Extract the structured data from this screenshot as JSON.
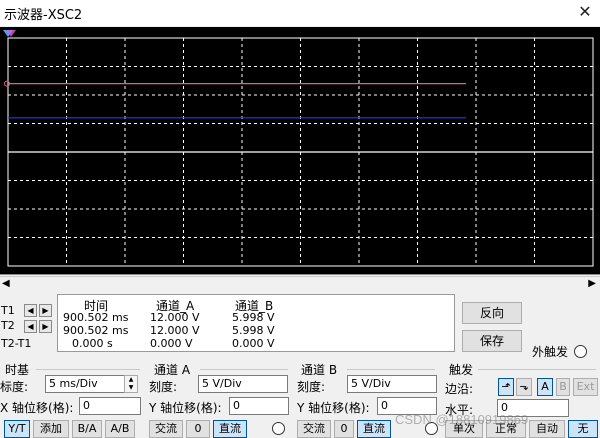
{
  "window": {
    "title": "示波器-XSC2",
    "close": "✕"
  },
  "cursors": {
    "t1_label": "T1",
    "t2_label": "T2",
    "diff_label": "T2-T1",
    "headers": {
      "time": "时间",
      "a": "通道_A",
      "b": "通道_B"
    },
    "rows": [
      {
        "time": "900.502 ms",
        "a": "12.000 V",
        "b": "5.998 V"
      },
      {
        "time": "900.502 ms",
        "a": "12.000 V",
        "b": "5.998 V"
      },
      {
        "time": "0.000 s",
        "a": "0.000 V",
        "b": "0.000 V"
      }
    ]
  },
  "buttons": {
    "reverse": "反向",
    "save": "保存",
    "ext_trigger": "外触发"
  },
  "timebase": {
    "title": "时基",
    "scale_label": "标度:",
    "scale_value": "5 ms/Div",
    "xpos_label": "X 轴位移(格):",
    "xpos_value": "0",
    "modes": [
      "Y/T",
      "添加",
      "B/A",
      "A/B"
    ]
  },
  "channel_a": {
    "title": "通道 A",
    "scale_label": "刻度:",
    "scale_value": "5  V/Div",
    "ypos_label": "Y 轴位移(格):",
    "ypos_value": "0",
    "coupling": [
      "交流",
      "0",
      "直流"
    ]
  },
  "channel_b": {
    "title": "通道 B",
    "scale_label": "刻度:",
    "scale_value": "5  V/Div",
    "ypos_label": "Y 轴位移(格):",
    "ypos_value": "0",
    "coupling": [
      "交流",
      "0",
      "直流"
    ]
  },
  "trigger": {
    "title": "触发",
    "edge_label": "边沿:",
    "edge_buttons": [
      "⬏",
      "⬎"
    ],
    "source_buttons": [
      "A",
      "B",
      "Ext"
    ],
    "level_label": "水平:",
    "level_value": "0",
    "modes": [
      "单次",
      "正常",
      "自动",
      "无"
    ]
  },
  "watermark": "CSDN @18810919869",
  "colors": {
    "channel_a": "#e06080",
    "channel_b": "#3030ff",
    "trace_grid": "#ffffff"
  },
  "chart_data": {
    "type": "line",
    "grid": true,
    "series": [
      {
        "values": [
          12,
          12
        ]
      },
      {
        "values": [
          6,
          6
        ]
      }
    ]
  }
}
